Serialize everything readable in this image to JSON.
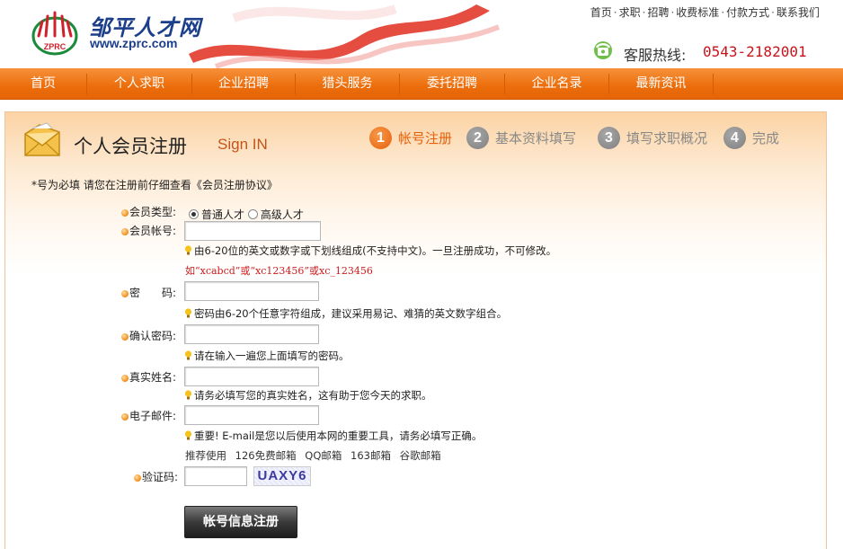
{
  "header": {
    "logo_title": "邹平人才网",
    "logo_url": "www.zprc.com",
    "logo_emblem_text": "ZPRC",
    "top_links": [
      "首页",
      "求职",
      "招聘",
      "收费标准",
      "付款方式",
      "联系我们"
    ],
    "hotline_label": "客服热线:",
    "hotline_number": "0543-2182001"
  },
  "nav": {
    "items": [
      "首页",
      "个人求职",
      "企业招聘",
      "猎头服务",
      "委托招聘",
      "企业名录",
      "最新资讯"
    ]
  },
  "panel": {
    "title": "个人会员注册",
    "subtitle": "Sign IN",
    "steps": [
      {
        "num": "1",
        "label": "帐号注册",
        "active": true
      },
      {
        "num": "2",
        "label": "基本资料填写",
        "active": false
      },
      {
        "num": "3",
        "label": "填写求职概况",
        "active": false
      },
      {
        "num": "4",
        "label": "完成",
        "active": false
      }
    ],
    "required_note": "*号为必填 请您在注册前仔细查看《会员注册协议》"
  },
  "form": {
    "member_type_label": "会员类型:",
    "member_type_options": [
      "普通人才",
      "高级人才"
    ],
    "member_type_selected": "普通人才",
    "account_label": "会员帐号:",
    "account_value": "",
    "account_hint": "由6-20位的英文或数字或下划线组成(不支持中文)。一旦注册成功，不可修改。",
    "account_example": "如“xcabcd”或“xc123456”或xc_123456",
    "password_label": "密　　码:",
    "password_hint": "密码由6-20个任意字符组成，建议采用易记、难猜的英文数字组合。",
    "confirm_label": "确认密码:",
    "confirm_hint": "请在输入一遍您上面填写的密码。",
    "realname_label": "真实姓名:",
    "realname_hint": "请务必填写您的真实姓名，这有助于您今天的求职。",
    "email_label": "电子邮件:",
    "email_hint": "重要! E-mail是您以后使用本网的重要工具，请务必填写正确。",
    "email_recommend_label": "推荐使用",
    "email_recommend": [
      "126免费邮箱",
      "QQ邮箱",
      "163邮箱",
      "谷歌邮箱"
    ],
    "captcha_label": "验证码:",
    "captcha_text": "UAXY6",
    "submit_label": "帐号信息注册"
  },
  "colors": {
    "nav_orange": "#ec6d0b",
    "accent_red": "#c8131a",
    "step_active": "#e4600a"
  }
}
